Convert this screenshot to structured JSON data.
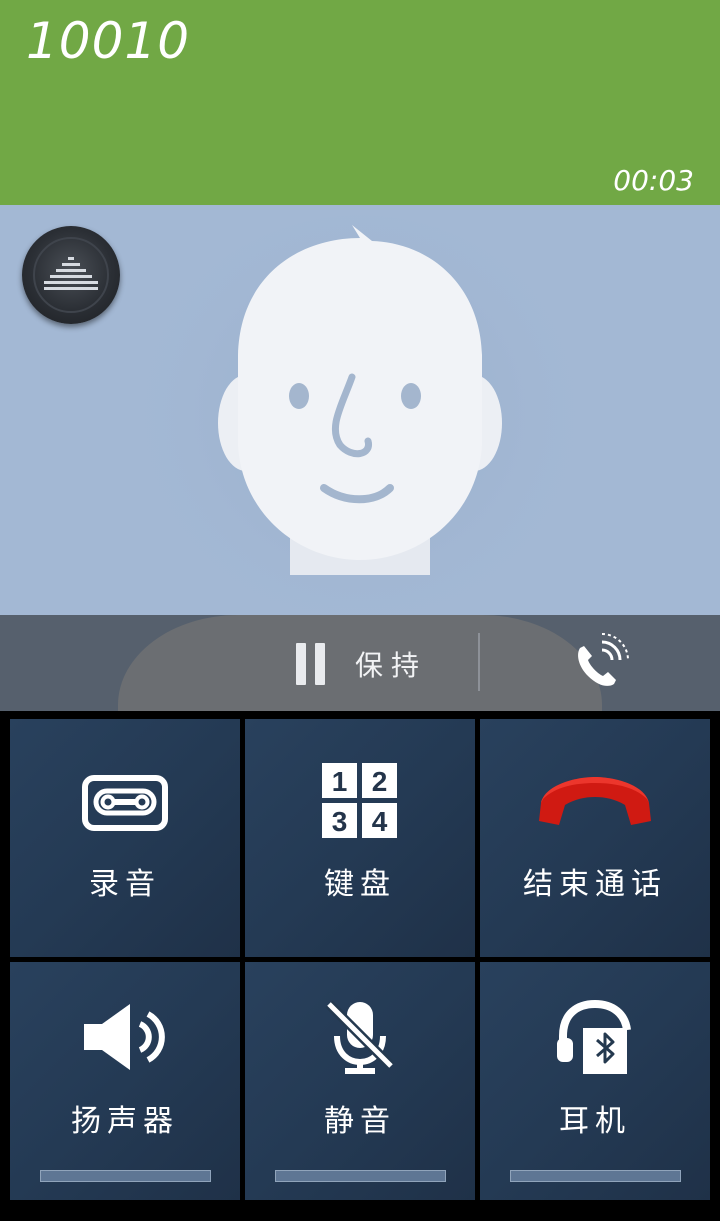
{
  "call": {
    "number": "10010",
    "duration": "00:03"
  },
  "controls": {
    "hold_label": "保持",
    "equalizer_icon": "equalizer-icon",
    "wifi_call_icon": "wifi-call-icon"
  },
  "actions": [
    {
      "label": "录音",
      "icon": "record-tape-icon"
    },
    {
      "label": "键盘",
      "icon": "keypad-icon"
    },
    {
      "label": "结束通话",
      "icon": "end-call-icon"
    },
    {
      "label": "扬声器",
      "icon": "speaker-icon"
    },
    {
      "label": "静音",
      "icon": "mute-mic-icon"
    },
    {
      "label": "耳机",
      "icon": "bluetooth-headset-icon"
    }
  ],
  "colors": {
    "header": "#71a845",
    "photo_bg": "#a3b8d4",
    "tile": "#243a54",
    "end_call": "#d01a12"
  }
}
